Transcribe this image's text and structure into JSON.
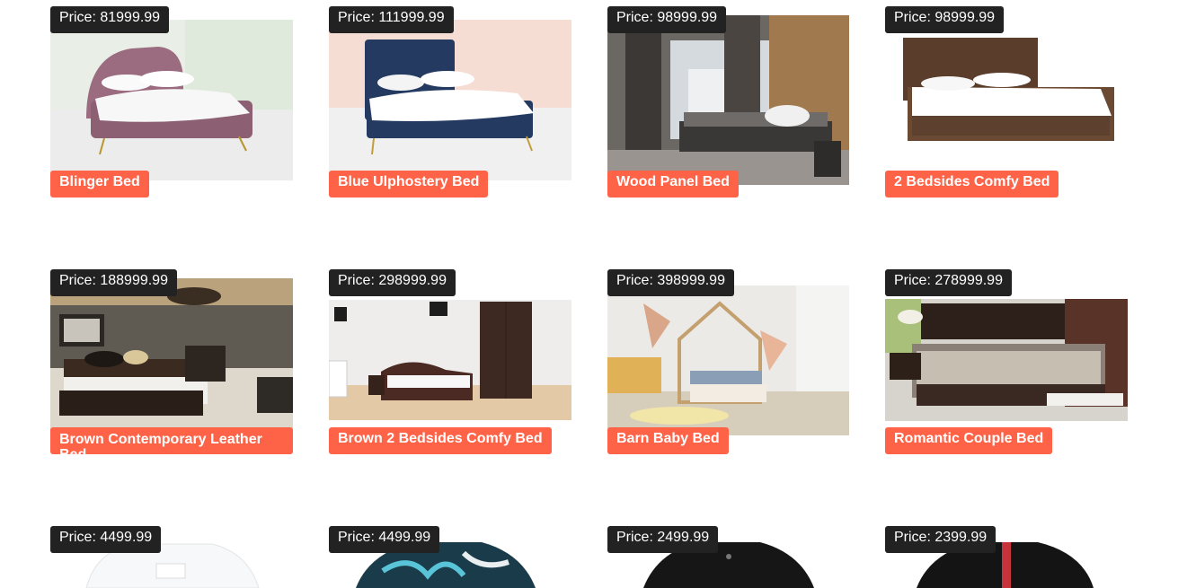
{
  "products": [
    {
      "price": "Price: 81999.99",
      "name": "Blinger Bed"
    },
    {
      "price": "Price: 111999.99",
      "name": "Blue Ulphostery Bed"
    },
    {
      "price": "Price: 98999.99",
      "name": "Wood Panel Bed"
    },
    {
      "price": "Price: 98999.99",
      "name": "2 Bedsides Comfy Bed"
    },
    {
      "price": "Price: 188999.99",
      "name": "Brown Contemporary Leather Bed"
    },
    {
      "price": "Price: 298999.99",
      "name": "Brown 2 Bedsides Comfy Bed"
    },
    {
      "price": "Price: 398999.99",
      "name": "Barn Baby Bed"
    },
    {
      "price": "Price: 278999.99",
      "name": "Romantic Couple Bed"
    },
    {
      "price": "Price: 4499.99"
    },
    {
      "price": "Price: 4499.99"
    },
    {
      "price": "Price: 2499.99"
    },
    {
      "price": "Price: 2399.99"
    }
  ],
  "colors": {
    "price_tag": "#222222",
    "name_tag": "#ff6347"
  },
  "icons": [
    "bed-photo",
    "shirt-photo"
  ]
}
